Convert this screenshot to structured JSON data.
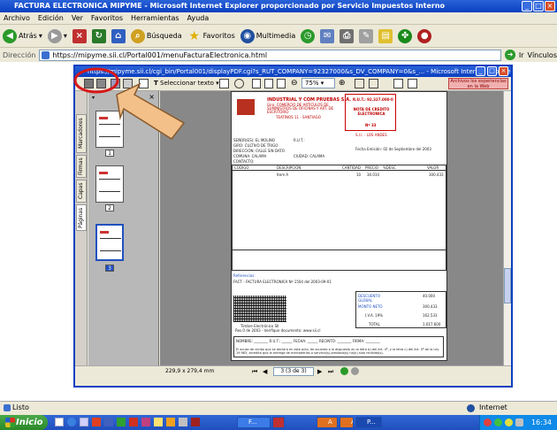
{
  "window": {
    "title": "FACTURA ELECTRONICA MIPYME - Microsoft Internet Explorer proporcionado por Servicio Impuestos Interno"
  },
  "menu": [
    "Archivo",
    "Edición",
    "Ver",
    "Favoritos",
    "Herramientas",
    "Ayuda"
  ],
  "toolbar": {
    "back_label": "Atrás",
    "search_label": "Búsqueda",
    "favorites_label": "Favoritos",
    "multimedia_label": "Multimedia"
  },
  "address": {
    "label": "Dirección",
    "url": "https://mipyme.sii.cl/Portal001/menuFacturaElectronica.html",
    "go_label": "Ir",
    "links_label": "Vínculos"
  },
  "popup": {
    "title": "https://mipyme.sii.cl/cgi_bin/Portal001/displayPDF.cgi?s_RUT_COMPANY=92327000&s_DV_COMPANY=0&s_... - Microsoft Internet Explorer p",
    "select_text_label": "Seleccionar texto",
    "zoom": "75%",
    "help_label": "Archivos los experiencias en la Web",
    "page_size": "229,9 x 279,4 mm",
    "page_indicator": "3 (3 de 3)",
    "sidebar_tabs": [
      "Marcadores",
      "Firmas",
      "Capas",
      "Páginas"
    ],
    "thumb_numbers": [
      "1",
      "2",
      "3"
    ]
  },
  "invoice": {
    "company": "INDUSTRIAL Y COM PRUEBAS S.A.",
    "giro": "Giro: COMERCIO DE ARTICULOS DE SUMINISTROS DE OFICINAS Y ART. DE ESCRITORIO",
    "address": "TEATINOS 11 - SANTIAGO",
    "rut": "R.U.T.: 92.327.000-0",
    "doc_type": "NOTA DE CREDITO ELECTRONICA",
    "number": "Nº 33",
    "sii": "S.I.I. - LOS ANDES",
    "senor": "SEÑOR(ES): EL MOLINO",
    "rut_cliente": "R.U.T.:",
    "giro_cliente": "GIRO: CULTIVO DE TRIGO",
    "direccion": "DIRECCION: CALLE SIN DATO",
    "comuna": "COMUNA: CALAMA",
    "ciudad": "CIUDAD: CALAMA",
    "contacto": "CONTACTO:",
    "fecha": "Fecha Emisión: 02 de Septiembre del 2003",
    "headers": [
      "CODIGO",
      "DESCRIPCION",
      "CANTIDAD",
      "PRECIO",
      "%DESC",
      "VALOR"
    ],
    "item": "Item A",
    "item_qty": "10",
    "item_price": "30.010",
    "item_value": "300.433",
    "referencias": "Referencias:",
    "ref_line": "FACT - FACTURA ELECTRONICA Nº 1504 del 2003-09-01",
    "totals_labels": [
      "DESCUENTO GLOBAL",
      "MONTO NETO",
      "I.V.A. 19%",
      "TOTAL"
    ],
    "totals_values": [
      "40.000",
      "300.433",
      "162.533",
      "1.017.600"
    ],
    "timbre": "Timbre Electrónico SII",
    "res": "Res.0 de 2003 - Verifique documento: www.sii.cl",
    "sign_line": "NOMBRE: ________ R.U.T.: ______ FECHA: ______ RECINTO: ________ FIRMA: ________",
    "acuse": "El acuse de recibo que se declara en este acto, de acuerdo a lo dispuesto en la letra b) del Art. 4º, y la letra c) del Art. 5º de la Ley 19.983, acredita que la entrega de mercaderías o servicio(s) prestado(s) ha(n) sido recibido(s)."
  },
  "status": {
    "left": "Listo",
    "zone": "Internet"
  },
  "taskbar": {
    "start": "Inicio",
    "items": [
      "F...",
      "M",
      "A",
      "A",
      "P..."
    ],
    "clock": "16:34"
  }
}
